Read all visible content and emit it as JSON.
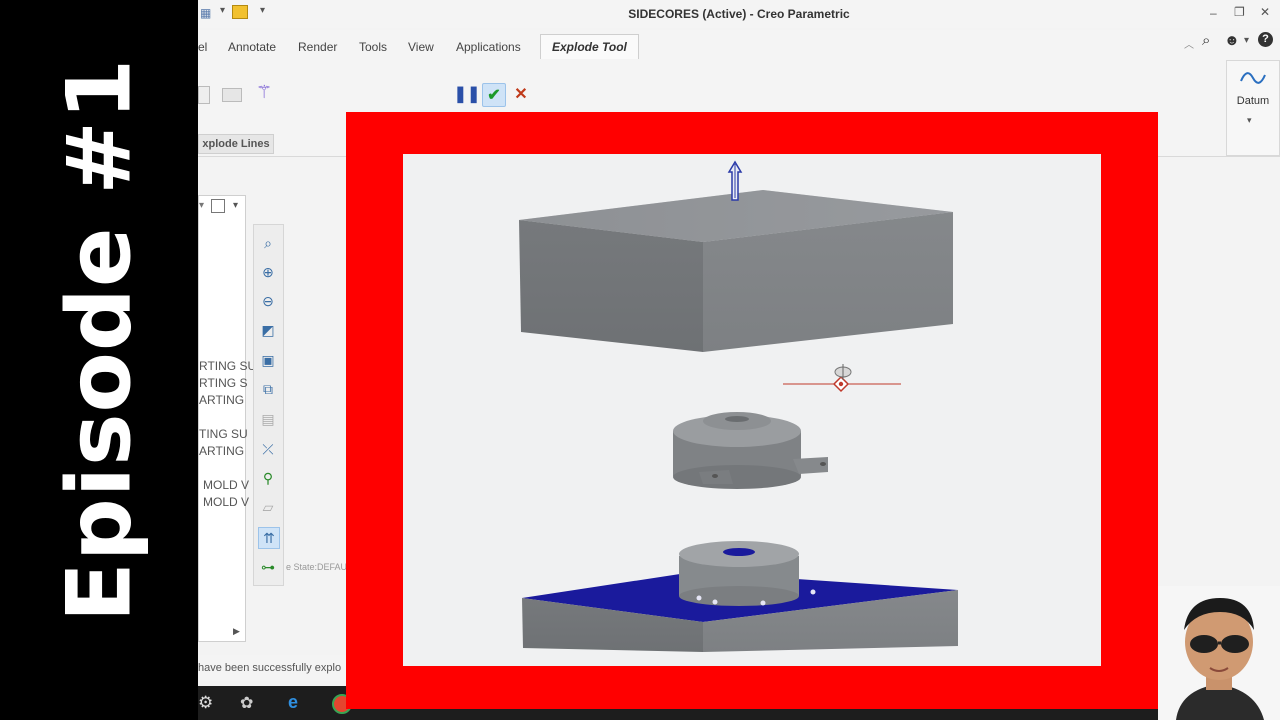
{
  "overlay": {
    "episode_text": "Episode #1"
  },
  "window": {
    "title": "SIDECORES (Active) - Creo Parametric"
  },
  "tabs": [
    {
      "label": "el"
    },
    {
      "label": "Annotate"
    },
    {
      "label": "Render"
    },
    {
      "label": "Tools"
    },
    {
      "label": "View"
    },
    {
      "label": "Applications"
    },
    {
      "label": "Explode Tool"
    }
  ],
  "ribbon": {
    "pause_icon": "pause-icon",
    "ok_icon": "checkmark-icon",
    "cancel_icon": "close-icon",
    "datum_label": "Datum",
    "explode_lines_label": "xplode Lines"
  },
  "tree": {
    "items": [
      "RTING SU",
      "RTING S",
      "ARTING",
      "TING SU",
      "ARTING",
      "MOLD V",
      "MOLD V"
    ]
  },
  "status": {
    "display_state": "e State:DEFAULT",
    "message": "have been successfully explo"
  },
  "colors": {
    "red_frame": "#ff0000",
    "model_gray": "#7a7d80",
    "plate_blue": "#1a1a9c",
    "banner": "#000000"
  }
}
